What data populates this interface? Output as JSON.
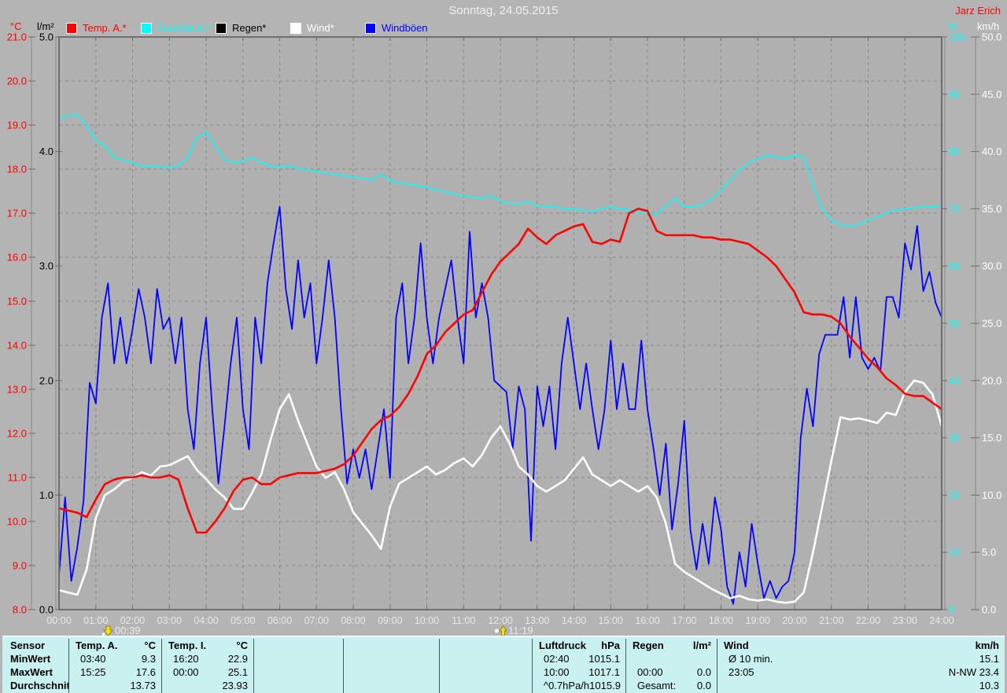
{
  "window": {
    "title": "Sonntag, 24.05.2015",
    "user": "Jarz Erich"
  },
  "legend": [
    {
      "label": "Temp. A.*",
      "color": "#ff0000",
      "icon": "red-square-swatch"
    },
    {
      "label": "Feuchte A.*",
      "color": "#00ffff",
      "icon": "cyan-square-swatch"
    },
    {
      "label": "Regen*",
      "color": "#000000",
      "icon": "black-square-swatch"
    },
    {
      "label": "Wind*",
      "color": "#ffffff",
      "icon": "white-square-swatch"
    },
    {
      "label": "Windböen",
      "color": "#0000ff",
      "icon": "blue-square-swatch"
    }
  ],
  "axes": {
    "left_temp": {
      "unit": "°C",
      "color": "#ff0000",
      "tick_labels": [
        "21.0",
        "20.0",
        "19.0",
        "18.0",
        "17.0",
        "16.0",
        "15.0",
        "14.0",
        "13.0",
        "12.0",
        "11.0",
        "10.0",
        "9.0",
        "8.0"
      ]
    },
    "left_rain": {
      "unit": "l/m²",
      "color": "#000000",
      "tick_labels": [
        "5.0",
        "4.0",
        "3.0",
        "2.0",
        "1.0",
        "0.0"
      ]
    },
    "right_humidity": {
      "unit": "%",
      "color": "#00ffff",
      "tick_labels": [
        "100",
        "90",
        "80",
        "70",
        "60",
        "50",
        "40",
        "30",
        "20",
        "10",
        "0"
      ]
    },
    "right_wind": {
      "unit": "km/h",
      "color": "#ffffff",
      "tick_labels": [
        "50.0",
        "45.0",
        "40.0",
        "35.0",
        "30.0",
        "25.0",
        "20.0",
        "15.0",
        "10.0",
        "5.0",
        "0.0"
      ]
    },
    "x_time": {
      "tick_labels": [
        "00:00",
        "01:00",
        "02:00",
        "03:00",
        "04:00",
        "05:00",
        "06:00",
        "07:00",
        "08:00",
        "09:00",
        "10:00",
        "11:00",
        "12:00",
        "13:00",
        "14:00",
        "15:00",
        "16:00",
        "17:00",
        "18:00",
        "19:00",
        "20:00",
        "21:00",
        "22:00",
        "23:00",
        "24:00"
      ]
    }
  },
  "markers": [
    {
      "time": "00:39",
      "minutes": 39,
      "icon": "moon-set-arrow-icon",
      "direction": "down"
    },
    {
      "time": "11:19",
      "minutes": 679,
      "icon": "moon-rise-arrow-icon",
      "direction": "up"
    }
  ],
  "chart_data": {
    "type": "line",
    "title": "Sonntag, 24.05.2015",
    "x_range_hours": [
      0,
      24
    ],
    "x_unit": "minutes_since_midnight",
    "grid": {
      "vertical_every_hours": 1,
      "horizontal_every_temp_deg": 1,
      "style": "dashed"
    },
    "axis_ranges": {
      "temp": [
        8,
        21
      ],
      "humidity": [
        0,
        100
      ],
      "wind": [
        0,
        50
      ],
      "rain": [
        0,
        5
      ]
    },
    "series": [
      {
        "name": "Feuchte A.",
        "unit": "%",
        "color": "#00ffff",
        "axis": "humidity",
        "step_min": 15,
        "values": [
          85.8,
          86.3,
          86.5,
          84.5,
          82,
          81,
          79,
          78.5,
          78,
          77.5,
          77.5,
          77.3,
          77.3,
          77.5,
          79,
          82.5,
          83.4,
          81,
          78.5,
          78,
          78.3,
          79,
          78,
          77.5,
          77.3,
          77.5,
          77,
          76.8,
          76.5,
          76.3,
          76,
          75.8,
          75.5,
          75.3,
          75,
          76,
          74.9,
          74.5,
          74.3,
          74,
          73.8,
          73.3,
          73,
          72.5,
          72.3,
          72,
          71.8,
          72.3,
          71.3,
          71,
          70.8,
          71.3,
          70.5,
          70.3,
          70.3,
          70,
          70,
          69.7,
          69.5,
          70,
          70.3,
          70,
          69.8,
          69.4,
          69.2,
          69,
          70.5,
          71.8,
          70.3,
          70.3,
          70.8,
          71.8,
          73.3,
          75,
          76.8,
          78,
          78.8,
          79.3,
          79,
          78.8,
          79.3,
          79,
          74,
          70,
          68,
          67.2,
          67,
          67.3,
          68,
          68.6,
          69.3,
          69.8,
          70,
          70.2,
          70.3,
          70.3,
          70.6
        ]
      },
      {
        "name": "Regen",
        "unit": "l/m²",
        "color": "#000000",
        "axis": "rain",
        "step_min": 60,
        "values": [
          0,
          0,
          0,
          0,
          0,
          0,
          0,
          0,
          0,
          0,
          0,
          0,
          0,
          0,
          0,
          0,
          0,
          0,
          0,
          0,
          0,
          0,
          0,
          0,
          0
        ]
      },
      {
        "name": "Windböen",
        "unit": "km/h",
        "color": "#0000ff",
        "axis": "wind",
        "step_min": 10,
        "values": [
          3,
          9.8,
          2.5,
          5.5,
          9.5,
          19.8,
          18,
          25.5,
          28.5,
          21.5,
          25.5,
          21.5,
          24.5,
          28,
          25.5,
          21.5,
          28,
          24.5,
          25.5,
          21.5,
          25.5,
          17.5,
          14,
          21.5,
          25.5,
          17.5,
          11,
          16,
          21.5,
          25.5,
          17.5,
          14,
          25.5,
          21.5,
          28.5,
          32,
          35.2,
          28,
          24.5,
          30.5,
          25.5,
          28.5,
          21.5,
          25.5,
          30.5,
          25.5,
          17.5,
          11,
          14,
          11.5,
          14,
          10.5,
          14,
          17.5,
          11.5,
          25.5,
          28.5,
          21.5,
          25.5,
          32,
          25.5,
          21.5,
          25.5,
          28,
          30.5,
          25.5,
          21.5,
          33,
          25.5,
          28.5,
          25.5,
          20,
          19.5,
          19,
          14,
          19.5,
          17.5,
          6,
          19.5,
          16,
          19.5,
          14,
          21.5,
          25.5,
          21.5,
          17.5,
          21.5,
          17.5,
          14,
          17.5,
          23.5,
          17.5,
          21.5,
          17.5,
          17.5,
          23.5,
          17.5,
          14,
          10,
          14.5,
          7,
          11,
          16.5,
          7,
          3.5,
          7.5,
          4,
          9.8,
          7,
          2,
          0.5,
          5,
          2,
          7.5,
          4,
          1,
          2.5,
          1,
          2,
          2.5,
          5,
          15,
          19.3,
          16,
          22.3,
          24,
          24,
          24,
          27.3,
          22,
          27.3,
          22,
          21,
          22,
          20.8,
          27.3,
          27.3,
          25.5,
          32,
          29.7,
          33.5,
          27.8,
          29.5,
          26.8,
          25.5
        ]
      },
      {
        "name": "Wind",
        "unit": "km/h",
        "color": "#ffffff",
        "axis": "wind",
        "step_min": 15,
        "values": [
          1.7,
          1.5,
          1.3,
          3.5,
          8,
          10,
          10.5,
          11.2,
          11.5,
          12,
          11.7,
          12.5,
          12.6,
          13,
          13.4,
          12.2,
          11.4,
          10.5,
          9.8,
          8.8,
          8.8,
          10.2,
          11.8,
          14.8,
          17.5,
          18.8,
          16.5,
          14.5,
          12.5,
          11.5,
          12,
          10.5,
          8.5,
          7.5,
          6.5,
          5.3,
          9,
          11,
          11.5,
          12,
          12.5,
          11.8,
          12.2,
          12.8,
          13.2,
          12.5,
          13.5,
          15,
          16,
          14.5,
          12.5,
          11.8,
          10.8,
          10.3,
          10.8,
          11.3,
          12.3,
          13.3,
          11.8,
          11.3,
          10.8,
          11.3,
          10.8,
          10.3,
          10.8,
          9.8,
          7.5,
          4,
          3.3,
          2.8,
          2.3,
          1.8,
          1.4,
          1,
          1.2,
          0.9,
          0.8,
          0.9,
          0.7,
          0.6,
          0.7,
          1.5,
          5,
          9,
          13,
          16.8,
          16.6,
          16.7,
          16.5,
          16.3,
          17.2,
          17,
          19,
          20,
          19.8,
          18.8,
          16
        ]
      },
      {
        "name": "Temp. A.",
        "unit": "°C",
        "color": "#ff0000",
        "axis": "temp",
        "step_min": 15,
        "values": [
          10.3,
          10.25,
          10.2,
          10.1,
          10.5,
          10.85,
          10.95,
          11,
          11,
          11.05,
          11,
          11,
          11.05,
          10.95,
          10.3,
          9.75,
          9.75,
          10,
          10.3,
          10.7,
          10.95,
          11,
          10.85,
          10.85,
          11,
          11.05,
          11.1,
          11.1,
          11.1,
          11.15,
          11.2,
          11.3,
          11.5,
          11.8,
          12.1,
          12.3,
          12.4,
          12.6,
          12.9,
          13.3,
          13.8,
          14,
          14.3,
          14.5,
          14.7,
          14.8,
          15.2,
          15.6,
          15.9,
          16.1,
          16.3,
          16.65,
          16.45,
          16.3,
          16.5,
          16.6,
          16.7,
          16.75,
          16.35,
          16.3,
          16.4,
          16.35,
          17,
          17.1,
          17.05,
          16.6,
          16.5,
          16.5,
          16.5,
          16.5,
          16.45,
          16.45,
          16.4,
          16.4,
          16.35,
          16.3,
          16.15,
          16,
          15.8,
          15.5,
          15.2,
          14.75,
          14.7,
          14.7,
          14.65,
          14.5,
          14.2,
          13.95,
          13.7,
          13.5,
          13.25,
          13.1,
          12.9,
          12.85,
          12.85,
          12.7,
          12.55
        ]
      }
    ]
  },
  "table": {
    "row_labels": [
      "Sensor",
      "MinWert",
      "MaxWert",
      "Durchschnitt"
    ],
    "columns": [
      {
        "header": "Temp. A.",
        "unit": "°C",
        "rows": [
          [
            "03:40",
            "9.3"
          ],
          [
            "15:25",
            "17.6"
          ],
          [
            "",
            "13.73"
          ]
        ]
      },
      {
        "header": "Temp. I.",
        "unit": "°C",
        "rows": [
          [
            "16:20",
            "22.9"
          ],
          [
            "00:00",
            "25.1"
          ],
          [
            "",
            "23.93"
          ]
        ]
      },
      {
        "header": "",
        "unit": "",
        "rows": [
          [
            "",
            ""
          ],
          [
            "",
            ""
          ],
          [
            "",
            ""
          ]
        ]
      },
      {
        "header": "",
        "unit": "",
        "rows": [
          [
            "",
            ""
          ],
          [
            "",
            ""
          ],
          [
            "",
            ""
          ]
        ]
      },
      {
        "header": "",
        "unit": "",
        "rows": [
          [
            "",
            ""
          ],
          [
            "",
            ""
          ],
          [
            "",
            ""
          ]
        ]
      },
      {
        "header": "Luftdruck",
        "unit": "hPa",
        "rows": [
          [
            "02:40",
            "1015.1"
          ],
          [
            "10:00",
            "1017.1"
          ],
          [
            "^0.7hPa/h",
            "1015.9"
          ]
        ]
      },
      {
        "header": "Regen",
        "unit": "l/m²",
        "rows": [
          [
            "",
            ""
          ],
          [
            "00:00",
            "0.0"
          ],
          [
            "Gesamt:",
            "0.0"
          ]
        ]
      },
      {
        "header": "Wind",
        "unit": "km/h",
        "rows": [
          [
            "Ø 10 min.",
            "15.1"
          ],
          [
            "23:05",
            "N-NW 23.4"
          ],
          [
            "",
            "10.3"
          ]
        ]
      }
    ]
  },
  "colors": {
    "background": "#b4b4b4",
    "plot_background": "#b0b0b0",
    "grid": "#8a8a8a",
    "frame": "#6e6e6e",
    "table_background": "#c9f1f0",
    "accent_red": "#ff0000",
    "accent_cyan": "#00ffff",
    "accent_blue": "#0000ff"
  }
}
